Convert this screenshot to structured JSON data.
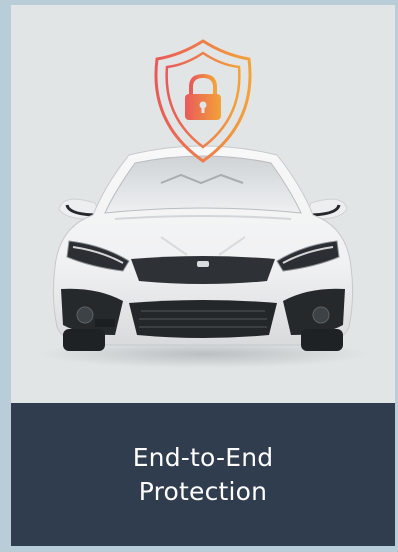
{
  "card": {
    "title": "End-to-End Protection",
    "image_subject": "car-front-view",
    "badge_icon": "shield-lock-icon"
  },
  "colors": {
    "page_background": "#b9cdd9",
    "image_background": "#e2e5e5",
    "caption_background": "#303d4e",
    "caption_text": "#ffffff",
    "shield_gradient_start": "#e85a5a",
    "shield_gradient_end": "#f3a23a"
  }
}
